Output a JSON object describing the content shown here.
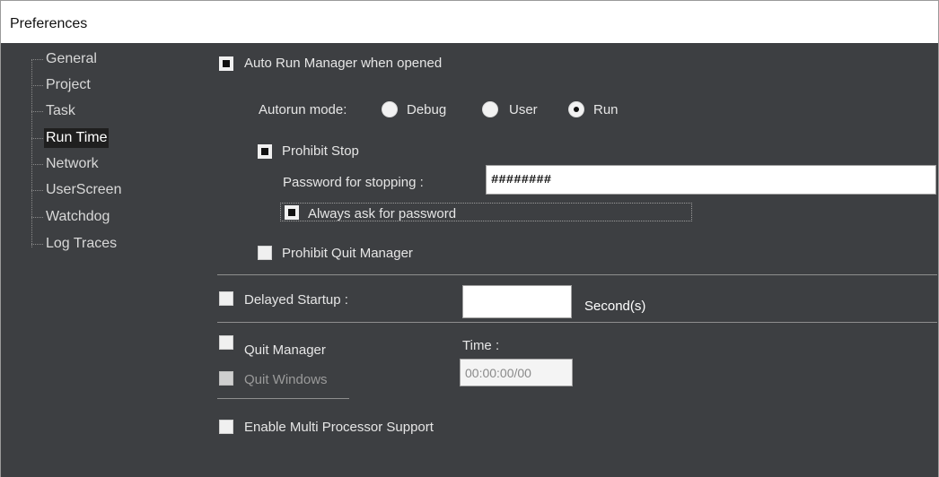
{
  "window": {
    "title": "Preferences"
  },
  "tree": {
    "items": [
      {
        "label": "General"
      },
      {
        "label": "Project"
      },
      {
        "label": "Task"
      },
      {
        "label": "Run Time"
      },
      {
        "label": "Network"
      },
      {
        "label": "UserScreen"
      },
      {
        "label": "Watchdog"
      },
      {
        "label": "Log Traces"
      }
    ],
    "selected": "Run Time"
  },
  "settings": {
    "auto_run": {
      "label": "Auto Run Manager when opened",
      "checked": true
    },
    "autorun_mode": {
      "label": "Autorun mode:",
      "options": [
        {
          "label": "Debug"
        },
        {
          "label": "User"
        },
        {
          "label": "Run"
        }
      ],
      "selected": "Run"
    },
    "prohibit_stop": {
      "label": "Prohibit Stop",
      "checked": true
    },
    "password": {
      "label": "Password for stopping :",
      "value": "########"
    },
    "always_ask": {
      "label": "Always ask for password",
      "checked": true
    },
    "prohibit_quit": {
      "label": "Prohibit Quit Manager",
      "checked": false
    },
    "delayed_startup": {
      "label": "Delayed Startup :",
      "checked": false,
      "value": "",
      "unit": "Second(s)"
    },
    "quit_manager": {
      "label": "Quit Manager",
      "checked": false
    },
    "quit_windows": {
      "label": "Quit Windows",
      "checked": false,
      "disabled": true
    },
    "time": {
      "label": "Time :",
      "value": "00:00:00/00"
    },
    "multi_processor": {
      "label": "Enable Multi Processor Support",
      "checked": false
    }
  }
}
